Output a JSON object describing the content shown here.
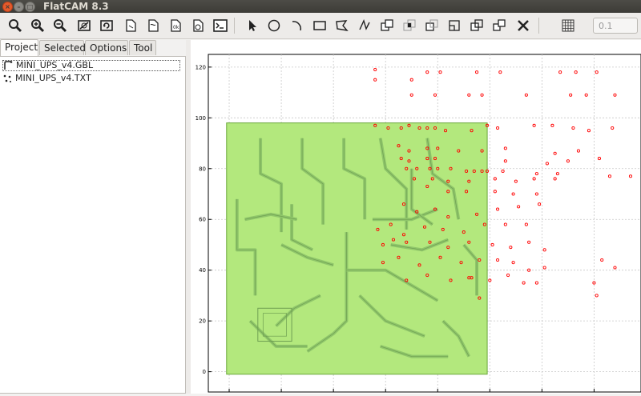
{
  "window": {
    "title": "FlatCAM 8.3"
  },
  "toolbar": {
    "icons": [
      "zoom-fit-icon",
      "zoom-in-icon",
      "zoom-out-icon",
      "clear-plot-icon",
      "replot-icon",
      "new-geometry-icon",
      "open-gerber-icon",
      "open-excellon-icon",
      "delete-icon",
      "shell-icon",
      "select-icon",
      "circle-icon",
      "arc-icon",
      "rectangle-icon",
      "polygon-icon",
      "path-icon",
      "union-icon",
      "intersection-icon",
      "subtract-icon",
      "cut-path-icon",
      "copy-shape-icon",
      "move-icon",
      "delete-shape-icon",
      "grid-icon"
    ],
    "grid_value": "0.1"
  },
  "tabs": [
    "Project",
    "Selected",
    "Options",
    "Tool"
  ],
  "project": {
    "items": [
      {
        "label": "MINI_UPS_v4.GBL",
        "icon": "gerber-icon",
        "selected": true
      },
      {
        "label": "MINI_UPS_v4.TXT",
        "icon": "excellon-icon",
        "selected": false
      }
    ]
  },
  "chart_data": {
    "type": "scatter",
    "title": "",
    "xlabel": "",
    "ylabel": "",
    "xlim": [
      -8,
      158
    ],
    "ylim": [
      -8,
      125
    ],
    "x_ticks": [
      0,
      20,
      40,
      60,
      80,
      100,
      120,
      140
    ],
    "y_ticks": [
      0,
      20,
      40,
      60,
      80,
      100,
      120
    ],
    "grid": true,
    "board_outline": {
      "x": [
        -1,
        99
      ],
      "y": [
        -1,
        98
      ]
    },
    "colors": {
      "board_fill": "#b3e87d",
      "board_edge": "#6aa83a",
      "drill": "#ff0000"
    },
    "drills_x": [
      56,
      56,
      70,
      76,
      81,
      95,
      104,
      127,
      133,
      141,
      70,
      79,
      92,
      97,
      114,
      131,
      137,
      148,
      56,
      61,
      66,
      69,
      73,
      76,
      79,
      83,
      93,
      99,
      103,
      117,
      124,
      132,
      138,
      147,
      65,
      69,
      76,
      80,
      88,
      97,
      106,
      125,
      134,
      66,
      69,
      76,
      79,
      106,
      122,
      130,
      142,
      68,
      72,
      77,
      80,
      85,
      91,
      94,
      97,
      99,
      105,
      118,
      126,
      71,
      78,
      84,
      92,
      102,
      110,
      117,
      125,
      146,
      154,
      76,
      84,
      91,
      102,
      109,
      118,
      67,
      72,
      79,
      84,
      95,
      103,
      111,
      119,
      57,
      62,
      67,
      75,
      82,
      90,
      98,
      106,
      114,
      59,
      63,
      68,
      77,
      84,
      92,
      101,
      108,
      115,
      121,
      143,
      148,
      59,
      65,
      73,
      81,
      89,
      96,
      103,
      109,
      115,
      121,
      68,
      76,
      85,
      93,
      100,
      107,
      113,
      141,
      92,
      118,
      96,
      140
    ],
    "drills_y": [
      115,
      119,
      115,
      118,
      118,
      118,
      118,
      118,
      118,
      118,
      109,
      109,
      109,
      109,
      109,
      109,
      109,
      109,
      97,
      96,
      96,
      97,
      96,
      96,
      96,
      95,
      95,
      97,
      96,
      97,
      97,
      96,
      95,
      96,
      89,
      87,
      88,
      88,
      87,
      87,
      88,
      86,
      87,
      84,
      83,
      84,
      84,
      83,
      82,
      83,
      84,
      80,
      80,
      80,
      80,
      80,
      79,
      79,
      79,
      79,
      79,
      78,
      78,
      76,
      76,
      75,
      75,
      76,
      75,
      76,
      76,
      77,
      77,
      73,
      71,
      71,
      71,
      70,
      70,
      66,
      63,
      64,
      61,
      62,
      64,
      65,
      66,
      56,
      58,
      54,
      57,
      56,
      55,
      58,
      58,
      58,
      50,
      52,
      51,
      51,
      49,
      51,
      50,
      49,
      51,
      48,
      44,
      41,
      43,
      45,
      42,
      45,
      43,
      44,
      44,
      43,
      40,
      41,
      36,
      38,
      36,
      37,
      36,
      38,
      35,
      30,
      37,
      35,
      29,
      35
    ]
  }
}
